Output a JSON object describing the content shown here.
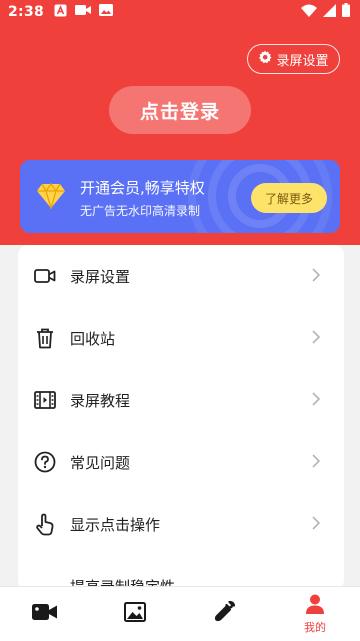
{
  "status_bar": {
    "time": "2:38",
    "left_icons": [
      "a-icon",
      "video-camera-icon",
      "image-icon"
    ],
    "right_icons": [
      "wifi-icon",
      "signal-icon",
      "battery-icon"
    ]
  },
  "header": {
    "settings_label": "录屏设置",
    "login_label": "点击登录"
  },
  "vip": {
    "title": "开通会员,畅享特权",
    "subtitle": "无广告无水印高清录制",
    "more_label": "了解更多"
  },
  "menu": {
    "items": [
      {
        "label": "录屏设置",
        "icon": "video-camera-icon"
      },
      {
        "label": "回收站",
        "icon": "trash-icon"
      },
      {
        "label": "录屏教程",
        "icon": "film-icon"
      },
      {
        "label": "常见问题",
        "icon": "question-icon"
      },
      {
        "label": "显示点击操作",
        "icon": "tap-hand-icon"
      },
      {
        "label": "提高录制稳定性",
        "icon": ""
      }
    ]
  },
  "bottom_nav": {
    "items": [
      {
        "icon": "video-camera-icon",
        "label": ""
      },
      {
        "icon": "image-icon",
        "label": ""
      },
      {
        "icon": "wrench-icon",
        "label": ""
      },
      {
        "icon": "person-icon",
        "label": "我的"
      }
    ]
  },
  "colors": {
    "brand_red": "#f0403c",
    "vip_blue": "#5a71f5",
    "vip_button": "#fde36a"
  }
}
